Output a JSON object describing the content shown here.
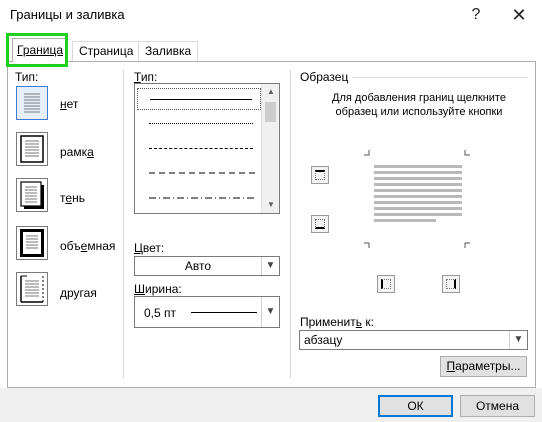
{
  "window": {
    "title": "Границы и заливка",
    "help_glyph": "?",
    "close_glyph": "✕"
  },
  "tabs": [
    {
      "label": "Граница",
      "active": true
    },
    {
      "label": "Страница",
      "active": false
    },
    {
      "label": "Заливка",
      "active": false
    }
  ],
  "setting": {
    "label": "Тип:",
    "items": [
      {
        "label": "нет",
        "icon": "none-border-icon",
        "selected": true
      },
      {
        "label": "рамка",
        "icon": "box-border-icon",
        "selected": false
      },
      {
        "label": "тень",
        "icon": "shadow-border-icon",
        "selected": false
      },
      {
        "label": "объемная",
        "icon": "3d-border-icon",
        "selected": false
      },
      {
        "label": "другая",
        "icon": "custom-border-icon",
        "selected": false
      }
    ]
  },
  "style": {
    "label": "Тип:",
    "lines": [
      "solid",
      "dotted",
      "dashed-small",
      "dashed",
      "dash-dot"
    ]
  },
  "color": {
    "label": "Цвет:",
    "value": "Авто"
  },
  "width": {
    "label": "Ширина:",
    "value": "0,5 пт"
  },
  "preview": {
    "label": "Образец",
    "instruction": "Для добавления границ щелкните образец или используйте кнопки"
  },
  "apply": {
    "label": "Применить к:",
    "value": "абзацу"
  },
  "buttons": {
    "options": "Параметры...",
    "ok": "ОК",
    "cancel": "Отмена"
  },
  "colors": {
    "highlight": "#1fd01f",
    "accent": "#0078d7"
  }
}
